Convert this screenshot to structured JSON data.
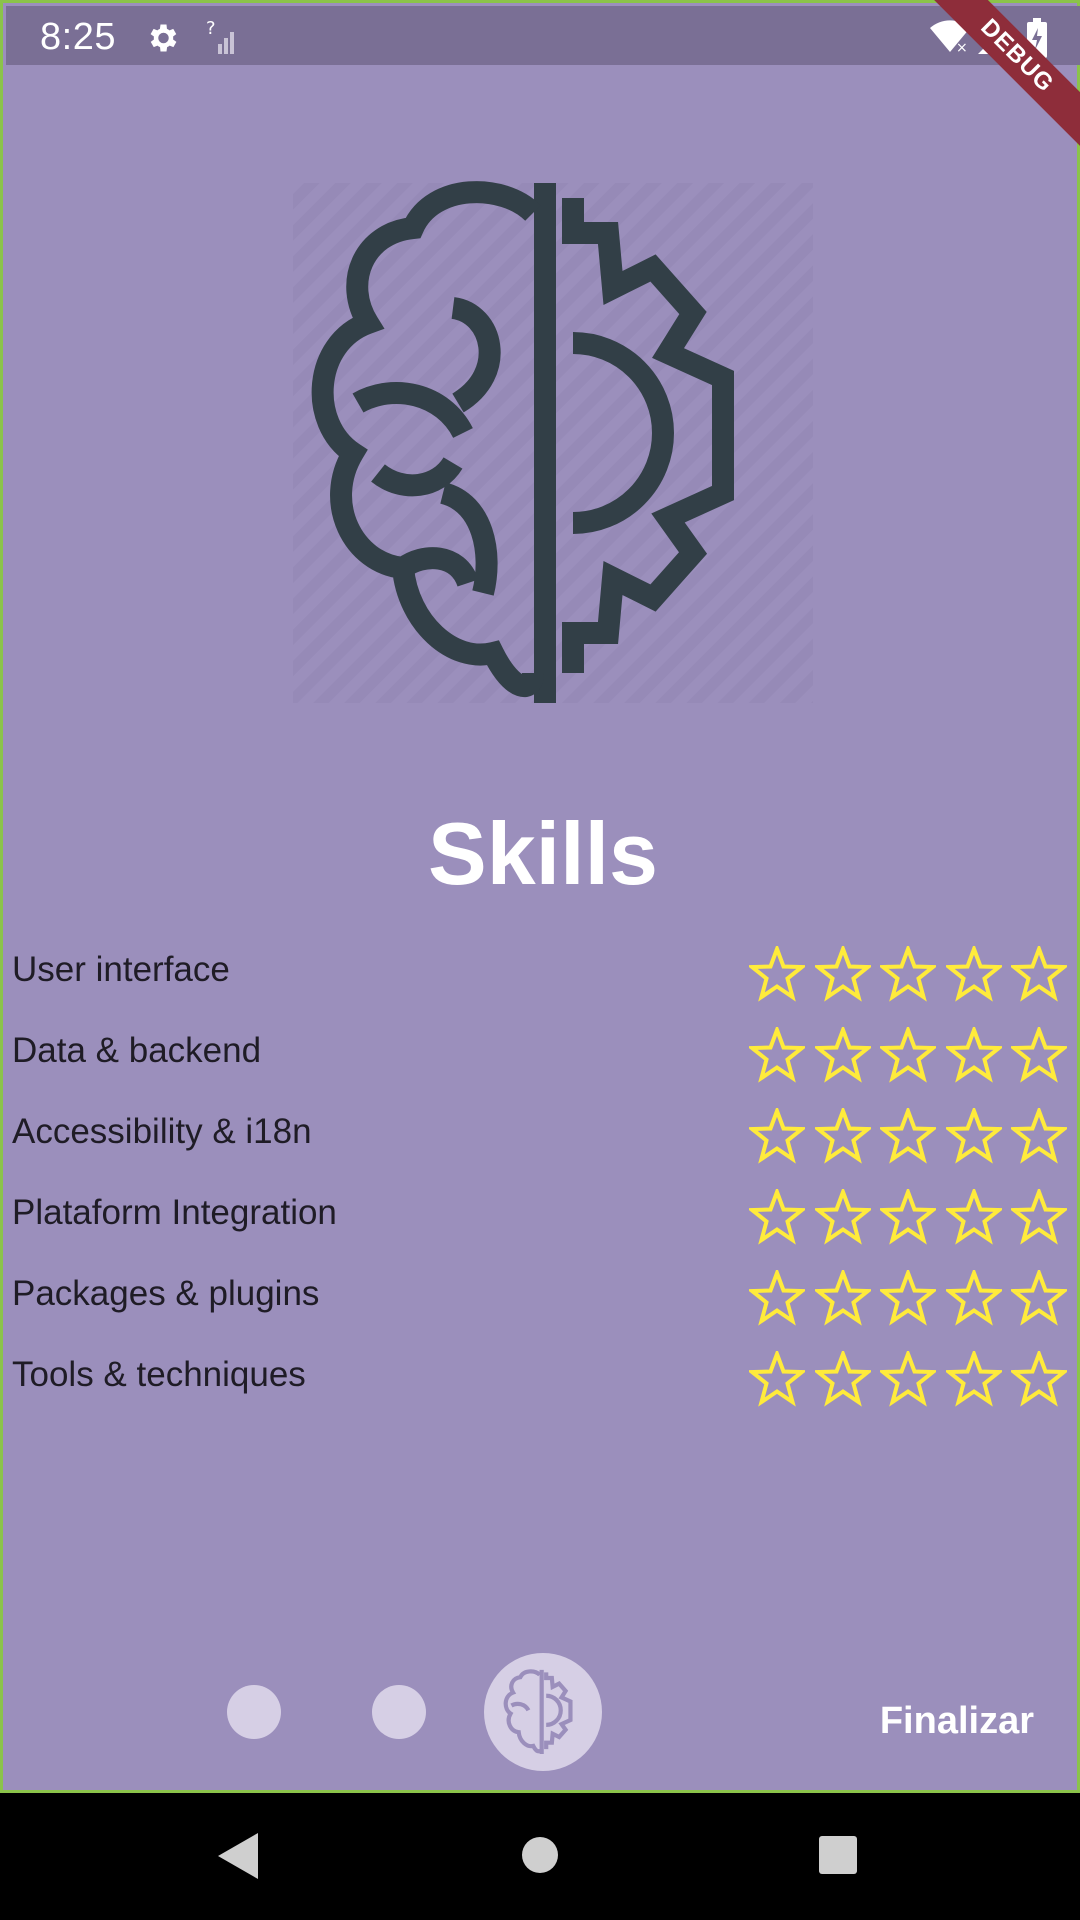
{
  "status_bar": {
    "time": "8:25",
    "icons": [
      "settings-icon",
      "signal-unknown-icon",
      "wifi-off-icon",
      "cell-signal-icon",
      "battery-charging-icon"
    ]
  },
  "debug_banner": "DEBUG",
  "hero_icon": "brain-gear-icon",
  "title": "Skills",
  "skills": [
    {
      "label": "User interface",
      "rating": 0,
      "max": 5
    },
    {
      "label": "Data & backend",
      "rating": 0,
      "max": 5
    },
    {
      "label": "Accessibility & i18n",
      "rating": 0,
      "max": 5
    },
    {
      "label": "Plataform Integration",
      "rating": 0,
      "max": 5
    },
    {
      "label": "Packages & plugins",
      "rating": 0,
      "max": 5
    },
    {
      "label": "Tools & techniques",
      "rating": 0,
      "max": 5
    }
  ],
  "pager": {
    "pages": 3,
    "current": 3
  },
  "finish_label": "Finalizar",
  "colors": {
    "background": "#9b8fbc",
    "status_bar": "#7a6f95",
    "icon_dark": "#323f47",
    "star": "#ffeb3b",
    "title": "#ffffff",
    "dot": "#d6cfe5"
  },
  "nav_buttons": [
    "back-icon",
    "home-icon",
    "recents-icon"
  ]
}
